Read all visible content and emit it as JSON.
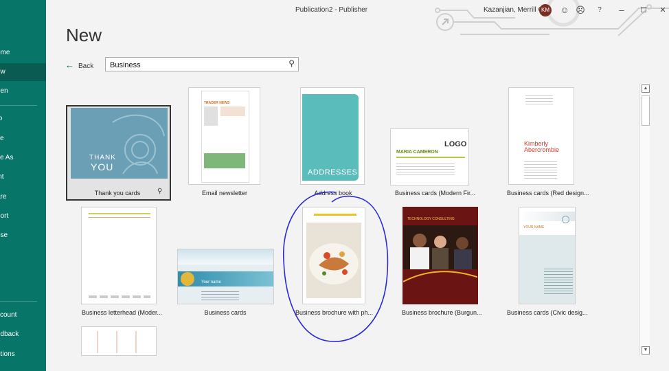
{
  "sidebar": {
    "items": [
      {
        "label": "ome"
      },
      {
        "label": "ew"
      },
      {
        "label": "pen"
      },
      {
        "label": "fo"
      },
      {
        "label": "ve"
      },
      {
        "label": "ve As"
      },
      {
        "label": "int"
      },
      {
        "label": "are"
      },
      {
        "label": "port"
      },
      {
        "label": "ose"
      },
      {
        "label": "ccount"
      },
      {
        "label": "edback"
      },
      {
        "label": "ptions"
      }
    ]
  },
  "titlebar": {
    "title": "Publication2 - Publisher",
    "user": "Kazanjian, Merrill G.",
    "avatar_initials": "KM",
    "help": "?",
    "minimize": "–",
    "maximize": "☐",
    "close": "✕"
  },
  "page": {
    "title": "New"
  },
  "back": {
    "label": "Back"
  },
  "search": {
    "value": "Business"
  },
  "templates": [
    {
      "label": "Thank you cards",
      "thumb_text_1": "THANK",
      "thumb_text_2": "YOU"
    },
    {
      "label": "Email newsletter",
      "thumb_text_1": "TRADER NEWS"
    },
    {
      "label": "Address book",
      "thumb_text_1": "ADDRESSES"
    },
    {
      "label": "Business cards (Modern Fir...",
      "thumb_text_1": "MARIA CAMERON",
      "thumb_text_2": "LOGO"
    },
    {
      "label": "Business cards (Red design...",
      "thumb_text_1": "Kimberly",
      "thumb_text_2": "Abercrombie"
    },
    {
      "label": "Business letterhead (Moder..."
    },
    {
      "label": "Business cards",
      "thumb_text_1": "Your name"
    },
    {
      "label": "Business brochure with ph..."
    },
    {
      "label": "Business brochure (Burgun...",
      "thumb_text_1": "TECHNOLOGY CONSULTING"
    },
    {
      "label": "Business cards (Civic desig...",
      "thumb_text_1": "YOUR NAME"
    }
  ],
  "colors": {
    "sidebar": "#077568",
    "accent": "#0a6b5f",
    "annotation": "#2a2ad8"
  }
}
